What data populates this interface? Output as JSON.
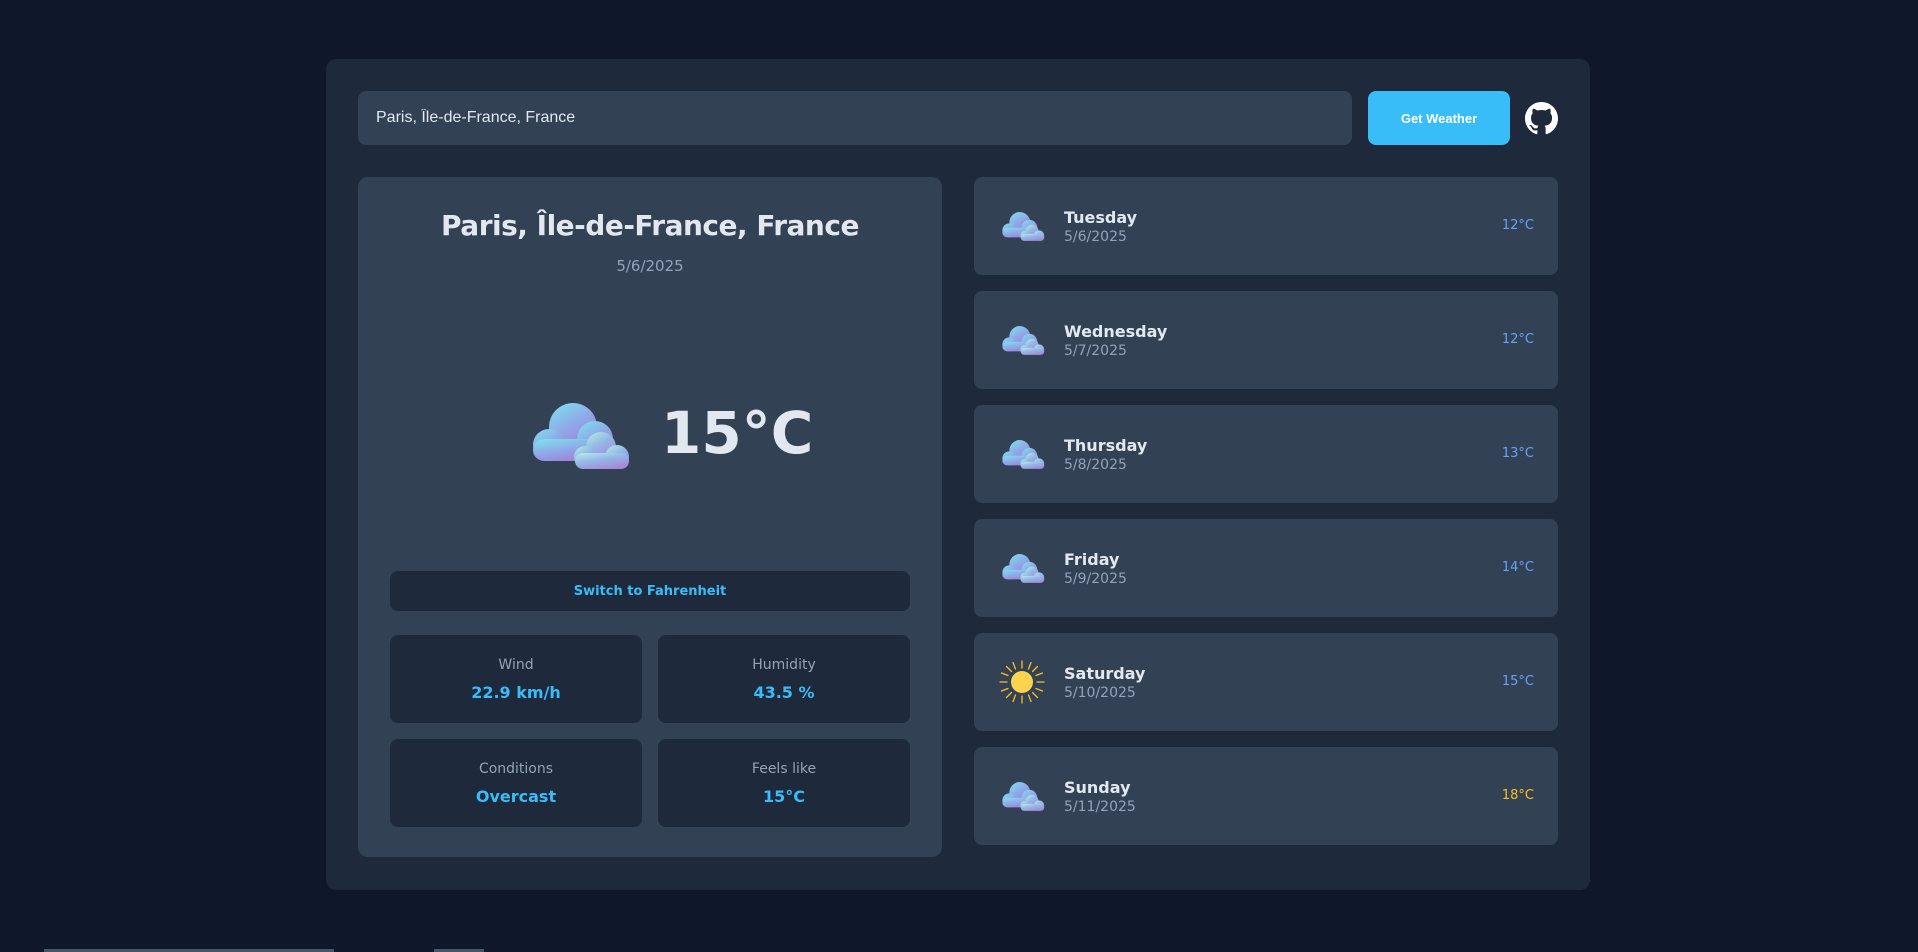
{
  "search": {
    "value": "Paris, Île-de-France, France",
    "button_label": "Get Weather"
  },
  "links": {
    "github_icon": "github-icon"
  },
  "current": {
    "city": "Paris, Île-de-France, France",
    "date": "5/6/2025",
    "icon": "cloud-icon",
    "temperature": "15°C",
    "unit_toggle_label": "Switch to Fahrenheit",
    "stats": [
      {
        "label": "Wind",
        "value": "22.9 km/h"
      },
      {
        "label": "Humidity",
        "value": "43.5 %"
      },
      {
        "label": "Conditions",
        "value": "Overcast"
      },
      {
        "label": "Feels like",
        "value": "15°C"
      }
    ]
  },
  "forecast": [
    {
      "day": "Tuesday",
      "date": "5/6/2025",
      "temp": "12°C",
      "icon": "cloud-icon",
      "temp_color": "#60a5fa"
    },
    {
      "day": "Wednesday",
      "date": "5/7/2025",
      "temp": "12°C",
      "icon": "cloud-icon",
      "temp_color": "#60a5fa"
    },
    {
      "day": "Thursday",
      "date": "5/8/2025",
      "temp": "13°C",
      "icon": "cloud-icon",
      "temp_color": "#60a5fa"
    },
    {
      "day": "Friday",
      "date": "5/9/2025",
      "temp": "14°C",
      "icon": "cloud-icon",
      "temp_color": "#60a5fa"
    },
    {
      "day": "Saturday",
      "date": "5/10/2025",
      "temp": "15°C",
      "icon": "sun-icon",
      "temp_color": "#60a5fa"
    },
    {
      "day": "Sunday",
      "date": "5/11/2025",
      "temp": "18°C",
      "icon": "cloud-icon",
      "temp_color": "#fbbf24"
    }
  ],
  "colors": {
    "page_bg": "#0f172a",
    "panel_bg": "#1e293b",
    "card_bg": "#334155",
    "accent": "#38bdf8",
    "text": "#e2e8f0",
    "muted": "#94a3b8"
  }
}
